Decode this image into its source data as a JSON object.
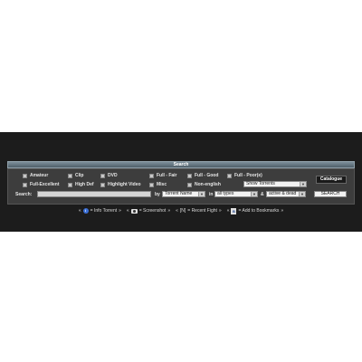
{
  "header": {
    "title": "Search"
  },
  "filters": {
    "row1": [
      "Amateur",
      "Clip",
      "DVD",
      "Full - Fair",
      "Full - Good",
      "Full - Poor(e)"
    ],
    "row2": [
      "Full-Excellent",
      "High Def",
      "Highlight Video",
      "Misc",
      "Non-english"
    ]
  },
  "show_select": {
    "value": "Show Torrents"
  },
  "catalogue_button": "Catalogue",
  "search_row": {
    "label": "Search:",
    "input_value": "",
    "by_label": "by",
    "by_select": "Torrent Name",
    "in_label": "in",
    "in_select": "all types",
    "amp_label": "&",
    "status_select": "active & dead",
    "search_button": "SEARCH"
  },
  "legend": {
    "info": "= Info Torrent",
    "screenshot": "= Screenshot",
    "recent_fight_mark": "[N]",
    "recent_fight": "= Recent Fight",
    "bookmarks": "= Add to Bookmarks"
  }
}
